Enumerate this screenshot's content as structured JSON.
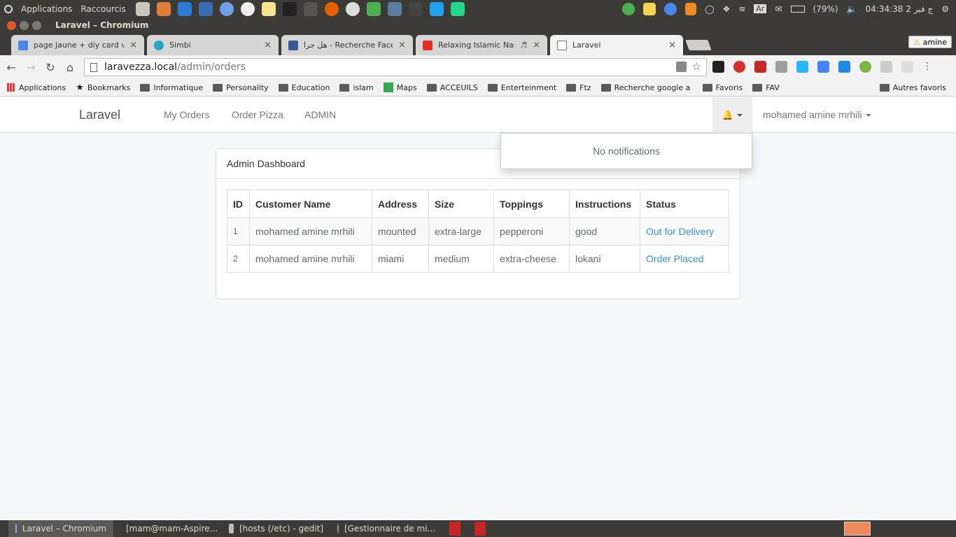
{
  "os_topbar": {
    "menu_items": [
      "Applications",
      "Raccourcis"
    ],
    "battery": "(79%)",
    "clock": "04:34:38 2 ج فبر",
    "keyboard": "Ar"
  },
  "window": {
    "title": "Laravel – Chromium"
  },
  "tabs": [
    {
      "label": "page jaune + diy card v + w",
      "favicon_color": "#4a86e8"
    },
    {
      "label": "Simbi",
      "favicon_color": "#2aa3c4"
    },
    {
      "label": "هل جرا - Recherche Facebo",
      "favicon_color": "#3b5998"
    },
    {
      "label": "Relaxing Islamic Nashe",
      "favicon_color": "#e52d27"
    },
    {
      "label": "Laravel",
      "favicon_color": "#ffffff"
    }
  ],
  "profile_chip": "amine",
  "omnibox": {
    "host": "laravezza.local",
    "path": "/admin/orders"
  },
  "bookmarks": [
    {
      "label": "Applications",
      "icon": "apps-grid-icon"
    },
    {
      "label": "Bookmarks",
      "icon": "star-icon"
    },
    {
      "label": "Informatique",
      "icon": "folder-icon"
    },
    {
      "label": "Personality",
      "icon": "folder-icon"
    },
    {
      "label": "Education",
      "icon": "folder-icon"
    },
    {
      "label": "islam",
      "icon": "folder-icon"
    },
    {
      "label": "Maps",
      "icon": "maps-icon"
    },
    {
      "label": "ACCEUILS",
      "icon": "folder-icon"
    },
    {
      "label": "Enterteinment",
      "icon": "folder-icon"
    },
    {
      "label": "Ftz",
      "icon": "folder-icon"
    },
    {
      "label": "Recherche google a tr",
      "icon": "folder-icon"
    },
    {
      "label": "Favoris",
      "icon": "folder-icon"
    },
    {
      "label": "FAV",
      "icon": "folder-icon"
    }
  ],
  "other_bookmarks": "Autres favoris",
  "app": {
    "brand": "Laravel",
    "nav": [
      "My Orders",
      "Order Pizza",
      "ADMIN"
    ],
    "user": "mohamed amine mrhili",
    "notifications_text": "No notifications"
  },
  "panel": {
    "heading": "Admin Dashboard",
    "columns": [
      "ID",
      "Customer Name",
      "Address",
      "Size",
      "Toppings",
      "Instructions",
      "Status"
    ],
    "rows": [
      [
        "1",
        "mohamed amine mrhili",
        "mounted",
        "extra-large",
        "pepperoni",
        "good",
        "Out for Delivery"
      ],
      [
        "2",
        "mohamed amine mrhili",
        "miami",
        "medium",
        "extra-cheese",
        "lokani",
        "Order Placed"
      ]
    ]
  },
  "taskbar": [
    {
      "label": "Laravel – Chromium",
      "active": true
    },
    {
      "label": "[mam@mam-Aspire...",
      "active": false
    },
    {
      "label": "[hosts (/etc) - gedit]",
      "active": false
    },
    {
      "label": "[Gestionnaire de mi...",
      "active": false
    }
  ],
  "colors": {
    "link": "#3097d1",
    "page_bg": "#f5f8fa"
  }
}
